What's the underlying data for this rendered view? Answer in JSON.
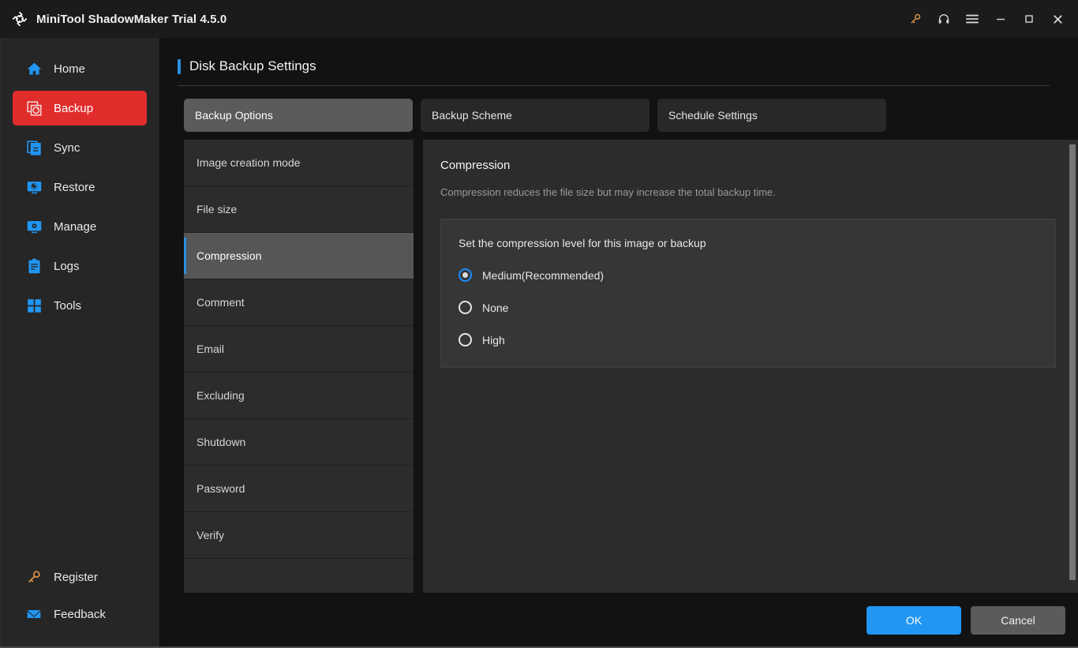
{
  "titlebar": {
    "app_title": "MiniTool ShadowMaker Trial 4.5.0",
    "logo_icon": "sync-arrows-icon",
    "controls": [
      {
        "name": "key-icon",
        "label": "Register",
        "color": "#d9924b"
      },
      {
        "name": "headset-icon",
        "label": "Support",
        "color": "#d4d4d4"
      },
      {
        "name": "hamburger-menu-icon",
        "label": "Menu",
        "color": "#d4d4d4"
      },
      {
        "name": "minimize-icon",
        "label": "Minimize",
        "color": "#d4d4d4"
      },
      {
        "name": "maximize-icon",
        "label": "Maximize",
        "color": "#d4d4d4"
      },
      {
        "name": "close-icon",
        "label": "Close",
        "color": "#d4d4d4"
      }
    ]
  },
  "sidebar": {
    "active_color": "#e12c2c",
    "icon_color": "#2196f3",
    "items": [
      {
        "label": "Home",
        "icon": "home-icon",
        "active": false
      },
      {
        "label": "Backup",
        "icon": "backup-icon",
        "active": true
      },
      {
        "label": "Sync",
        "icon": "sync-icon",
        "active": false
      },
      {
        "label": "Restore",
        "icon": "restore-icon",
        "active": false
      },
      {
        "label": "Manage",
        "icon": "manage-icon",
        "active": false
      },
      {
        "label": "Logs",
        "icon": "logs-icon",
        "active": false
      },
      {
        "label": "Tools",
        "icon": "tools-icon",
        "active": false
      }
    ],
    "bottom_items": [
      {
        "label": "Register",
        "icon": "key-icon",
        "color": "#d9924b"
      },
      {
        "label": "Feedback",
        "icon": "envelope-icon",
        "color": "#2196f3"
      }
    ]
  },
  "page": {
    "title": "Disk Backup Settings",
    "accent_color": "#2a8fe0"
  },
  "tabs": [
    {
      "label": "Backup Options",
      "active": true
    },
    {
      "label": "Backup Scheme",
      "active": false
    },
    {
      "label": "Schedule Settings",
      "active": false
    }
  ],
  "settings_list": [
    {
      "label": "Image creation mode",
      "selected": false
    },
    {
      "label": "File size",
      "selected": false
    },
    {
      "label": "Compression",
      "selected": true
    },
    {
      "label": "Comment",
      "selected": false
    },
    {
      "label": "Email",
      "selected": false
    },
    {
      "label": "Excluding",
      "selected": false
    },
    {
      "label": "Shutdown",
      "selected": false
    },
    {
      "label": "Password",
      "selected": false
    },
    {
      "label": "Verify",
      "selected": false
    }
  ],
  "content": {
    "title": "Compression",
    "description": "Compression reduces the file size but may increase the total backup time.",
    "card_heading": "Set the compression level for this image or backup",
    "options": [
      {
        "label": "Medium(Recommended)",
        "checked": true
      },
      {
        "label": "None",
        "checked": false
      },
      {
        "label": "High",
        "checked": false
      }
    ]
  },
  "footer": {
    "ok_label": "OK",
    "cancel_label": "Cancel",
    "ok_color": "#2196f3"
  }
}
